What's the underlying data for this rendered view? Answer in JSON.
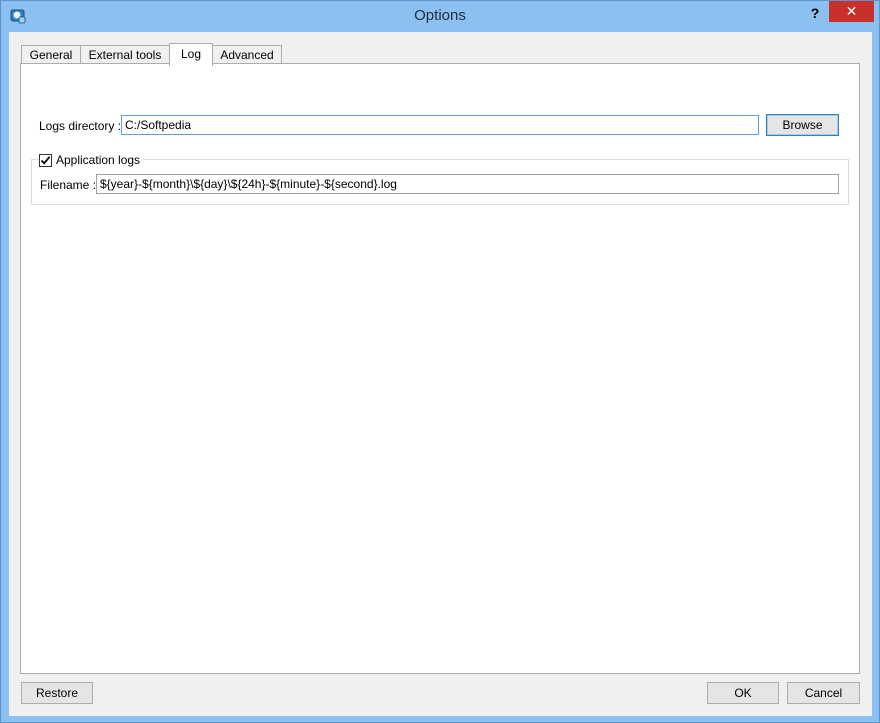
{
  "window": {
    "title": "Options",
    "help_label": "?",
    "close_label": "✕"
  },
  "tabs": [
    {
      "label": "General"
    },
    {
      "label": "External tools"
    },
    {
      "label": "Log"
    },
    {
      "label": "Advanced"
    }
  ],
  "log": {
    "logs_directory_label": "Logs directory :",
    "logs_directory_value": "C:/Softpedia",
    "browse_label": "Browse",
    "application_logs_label": "Application logs",
    "application_logs_checked": true,
    "filename_label": "Filename :",
    "filename_value": "${year}-${month}\\${day}\\${24h}-${minute}-${second}.log"
  },
  "footer": {
    "restore_label": "Restore",
    "ok_label": "OK",
    "cancel_label": "Cancel"
  },
  "colors": {
    "titlebar": "#8cc0f0",
    "close": "#c7302b",
    "focus_border": "#5f9fd6"
  }
}
